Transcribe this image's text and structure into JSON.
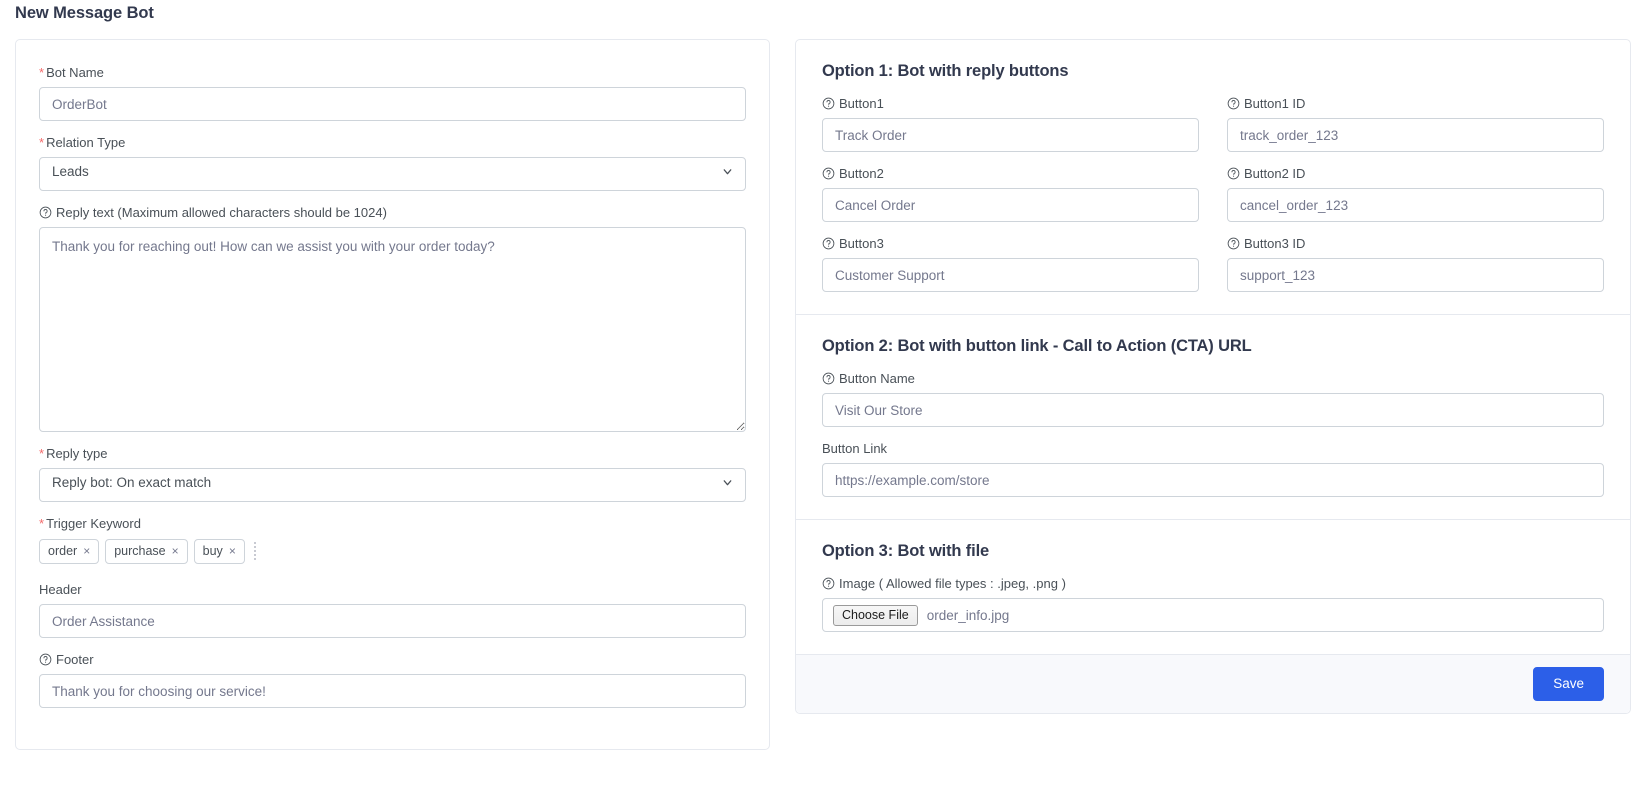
{
  "page": {
    "title": "New Message Bot"
  },
  "icons": {
    "help": "question-circle-icon",
    "chevron": "chevron-down-icon"
  },
  "colors": {
    "accent": "#2c5fe8",
    "required": "#f46a6a",
    "label": "#495057",
    "muted": "#74788d",
    "border": "#ced4da",
    "card_border": "#e6e9ef",
    "footer_bg": "#f8f9fc",
    "heading": "#32394e"
  },
  "left_panel": {
    "bot_name": {
      "label": "Bot Name",
      "required": true,
      "value": "OrderBot",
      "placeholder": "OrderBot"
    },
    "relation_type": {
      "label": "Relation Type",
      "required": true,
      "value": "Leads",
      "options": [
        "Leads"
      ]
    },
    "reply_text": {
      "label": "Reply text (Maximum allowed characters should be 1024)",
      "has_help": true,
      "value": "Thank you for reaching out! How can we assist you with your order today?",
      "placeholder": "Thank you for reaching out! How can we assist you with your order today?"
    },
    "reply_type": {
      "label": "Reply type",
      "required": true,
      "value": "Reply bot: On exact match",
      "options": [
        "Reply bot: On exact match"
      ]
    },
    "trigger_keyword": {
      "label": "Trigger Keyword",
      "required": true,
      "tags": [
        {
          "text": "order",
          "remove": "×"
        },
        {
          "text": "purchase",
          "remove": "×"
        },
        {
          "text": "buy",
          "remove": "×"
        }
      ]
    },
    "header": {
      "label": "Header",
      "has_help": false,
      "value": "Order Assistance",
      "placeholder": "Order Assistance"
    },
    "footer": {
      "label": "Footer",
      "has_help": true,
      "value": "Thank you for choosing our service!",
      "placeholder": "Thank you for choosing our service!"
    }
  },
  "option1": {
    "title": "Option 1: Bot with reply buttons",
    "rows": [
      {
        "name_label": "Button1",
        "name_value": "Track Order",
        "id_label": "Button1 ID",
        "id_value": "track_order_123"
      },
      {
        "name_label": "Button2",
        "name_value": "Cancel Order",
        "id_label": "Button2 ID",
        "id_value": "cancel_order_123"
      },
      {
        "name_label": "Button3",
        "name_value": "Customer Support",
        "id_label": "Button3 ID",
        "id_value": "support_123"
      }
    ]
  },
  "option2": {
    "title": "Option 2: Bot with button link - Call to Action (CTA) URL",
    "button_name": {
      "label": "Button Name",
      "has_help": true,
      "value": "Visit Our Store",
      "placeholder": "Visit Our Store"
    },
    "button_link": {
      "label": "Button Link",
      "has_help": false,
      "value": "https://example.com/store",
      "placeholder": "https://example.com/store"
    }
  },
  "option3": {
    "title": "Option 3: Bot with file",
    "image": {
      "label": "Image ( Allowed file types : .jpeg, .png )",
      "has_help": true,
      "choose_label": "Choose File",
      "file_name": "order_info.jpg"
    }
  },
  "footer_bar": {
    "save_label": "Save"
  }
}
